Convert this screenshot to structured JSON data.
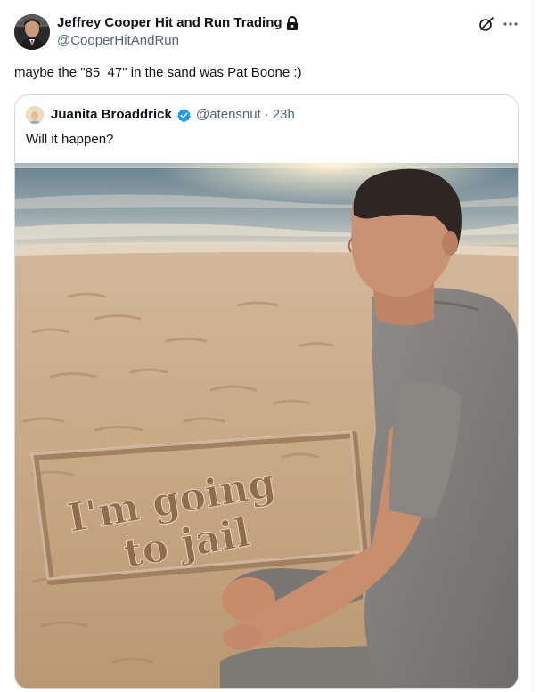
{
  "tweet": {
    "author_name": "Jeffrey Cooper Hit and Run Trading",
    "author_handle": "@CooperHitAndRun",
    "protected_icon": "lock-icon",
    "text": "maybe the \"85  47\" in the sand was Pat Boone :)",
    "actions": {
      "grok_icon": "grok-icon",
      "more_icon": "more-icon"
    }
  },
  "quoted_tweet": {
    "author_name": "Juanita Broaddrick",
    "verified_icon": "verified-icon",
    "author_handle": "@atensnut",
    "separator": "·",
    "time": "23h",
    "text": "Will it happen?",
    "image": {
      "description_icon": "photo",
      "sand_text_line1": "I'm going",
      "sand_text_line2": "to jail"
    }
  },
  "colors": {
    "text_primary": "#0f1419",
    "text_secondary": "#536471",
    "border": "#cfd9de",
    "verified_blue": "#1d9bf0"
  }
}
